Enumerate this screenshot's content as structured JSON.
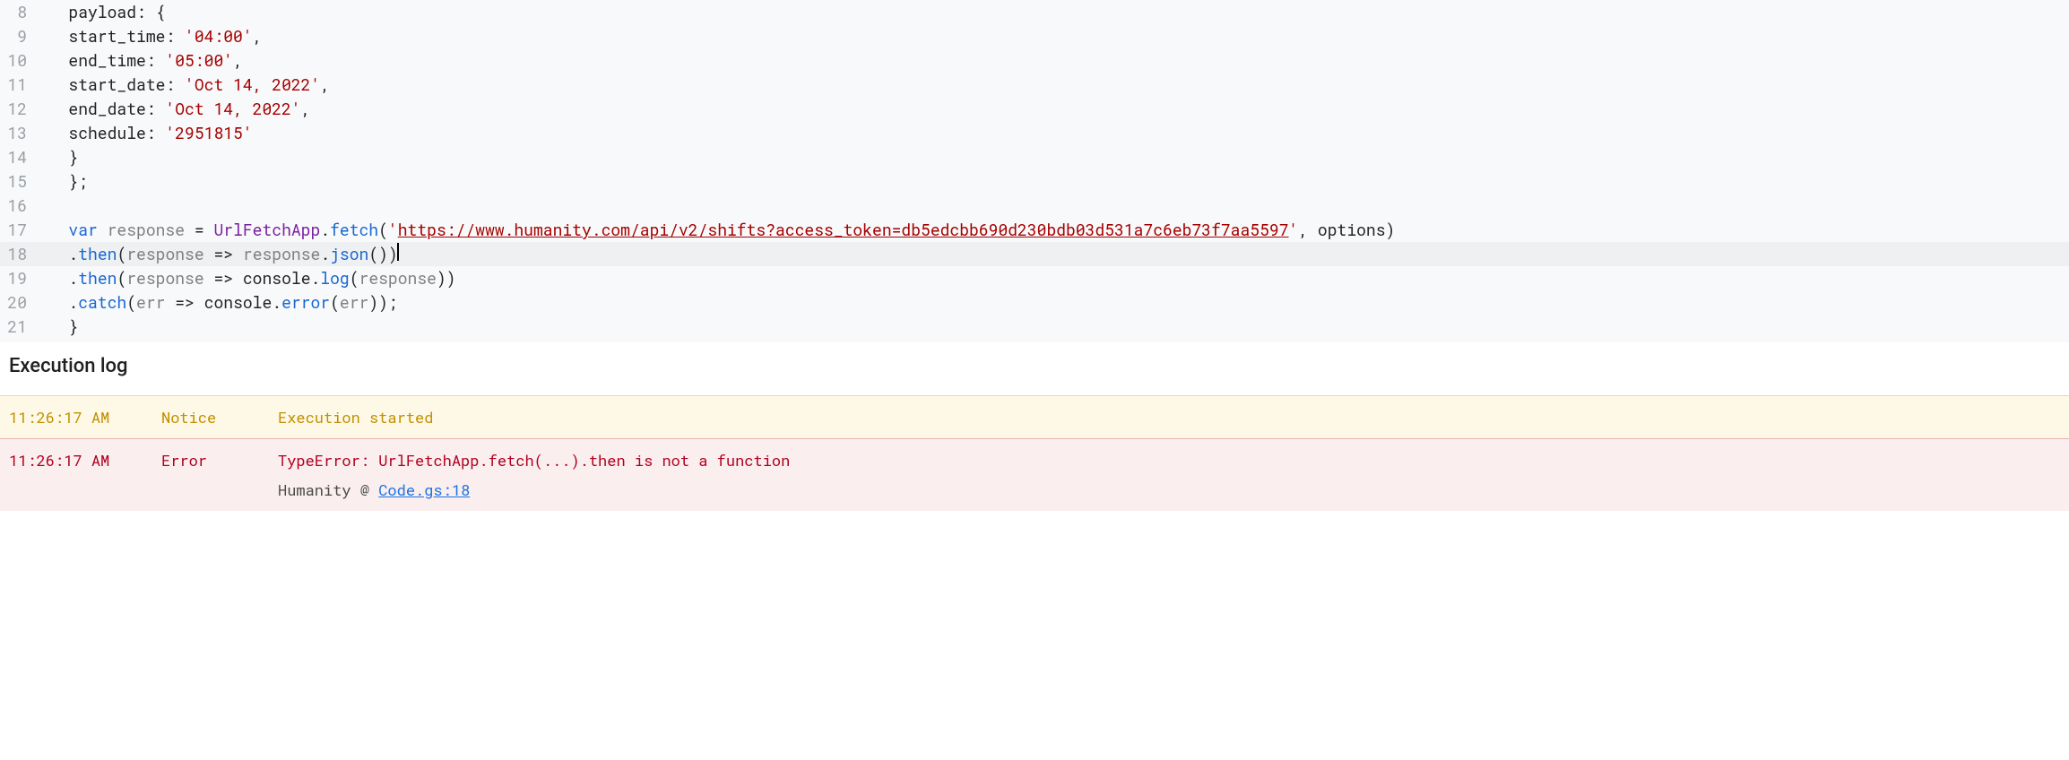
{
  "editor": {
    "lines": [
      {
        "num": 8,
        "tokens": [
          [
            "plain",
            "   payload"
          ],
          [
            "plain",
            ": {"
          ]
        ]
      },
      {
        "num": 9,
        "tokens": [
          [
            "plain",
            "   start_time"
          ],
          [
            "plain",
            ": "
          ],
          [
            "str",
            "'04:00'"
          ],
          [
            "plain",
            ","
          ]
        ]
      },
      {
        "num": 10,
        "tokens": [
          [
            "plain",
            "   end_time"
          ],
          [
            "plain",
            ": "
          ],
          [
            "str",
            "'05:00'"
          ],
          [
            "plain",
            ","
          ]
        ]
      },
      {
        "num": 11,
        "tokens": [
          [
            "plain",
            "   start_date"
          ],
          [
            "plain",
            ": "
          ],
          [
            "str",
            "'Oct 14, 2022'"
          ],
          [
            "plain",
            ","
          ]
        ]
      },
      {
        "num": 12,
        "tokens": [
          [
            "plain",
            "   end_date"
          ],
          [
            "plain",
            ": "
          ],
          [
            "str",
            "'Oct 14, 2022'"
          ],
          [
            "plain",
            ","
          ]
        ]
      },
      {
        "num": 13,
        "tokens": [
          [
            "plain",
            "   schedule"
          ],
          [
            "plain",
            ": "
          ],
          [
            "str",
            "'2951815'"
          ]
        ]
      },
      {
        "num": 14,
        "tokens": [
          [
            "plain",
            "   }"
          ]
        ]
      },
      {
        "num": 15,
        "tokens": [
          [
            "plain",
            "   };"
          ]
        ]
      },
      {
        "num": 16,
        "tokens": [
          [
            "plain",
            ""
          ]
        ]
      },
      {
        "num": 17,
        "tokens": [
          [
            "plain",
            "   "
          ],
          [
            "kw",
            "var"
          ],
          [
            "plain",
            " "
          ],
          [
            "ident",
            "response"
          ],
          [
            "plain",
            " = "
          ],
          [
            "obj",
            "UrlFetchApp"
          ],
          [
            "plain",
            "."
          ],
          [
            "meth",
            "fetch"
          ],
          [
            "plain",
            "("
          ],
          [
            "str",
            "'"
          ],
          [
            "url",
            "https://www.humanity.com/api/v2/shifts?access_token=db5edcbb690d230bdb03d531a7c6eb73f7aa5597"
          ],
          [
            "str",
            "'"
          ],
          [
            "plain",
            ", options)"
          ]
        ]
      },
      {
        "num": 18,
        "current": true,
        "tokens": [
          [
            "plain",
            "   ."
          ],
          [
            "meth",
            "then"
          ],
          [
            "plain",
            "("
          ],
          [
            "ident",
            "response"
          ],
          [
            "plain",
            " => "
          ],
          [
            "ident",
            "response"
          ],
          [
            "plain",
            "."
          ],
          [
            "meth",
            "json"
          ],
          [
            "plain",
            "())"
          ],
          [
            "cursor",
            ""
          ]
        ]
      },
      {
        "num": 19,
        "tokens": [
          [
            "plain",
            "   ."
          ],
          [
            "meth",
            "then"
          ],
          [
            "plain",
            "("
          ],
          [
            "ident",
            "response"
          ],
          [
            "plain",
            " => console."
          ],
          [
            "meth",
            "log"
          ],
          [
            "plain",
            "("
          ],
          [
            "ident",
            "response"
          ],
          [
            "plain",
            "))"
          ]
        ]
      },
      {
        "num": 20,
        "tokens": [
          [
            "plain",
            "   ."
          ],
          [
            "kw",
            "catch"
          ],
          [
            "plain",
            "("
          ],
          [
            "ident",
            "err"
          ],
          [
            "plain",
            " => console."
          ],
          [
            "meth",
            "error"
          ],
          [
            "plain",
            "("
          ],
          [
            "ident",
            "err"
          ],
          [
            "plain",
            "));"
          ]
        ]
      },
      {
        "num": 21,
        "tokens": [
          [
            "plain",
            "   }"
          ]
        ]
      }
    ]
  },
  "log": {
    "title": "Execution log",
    "entries": [
      {
        "time": "11:26:17 AM",
        "level": "Notice",
        "class": "notice",
        "message": "Execution started"
      },
      {
        "time": "11:26:17 AM",
        "level": "Error",
        "class": "error",
        "message": "TypeError: UrlFetchApp.fetch(...).then is not a function",
        "sub_prefix": "Humanity  @  ",
        "sub_link_text": "Code.gs:18"
      }
    ]
  }
}
